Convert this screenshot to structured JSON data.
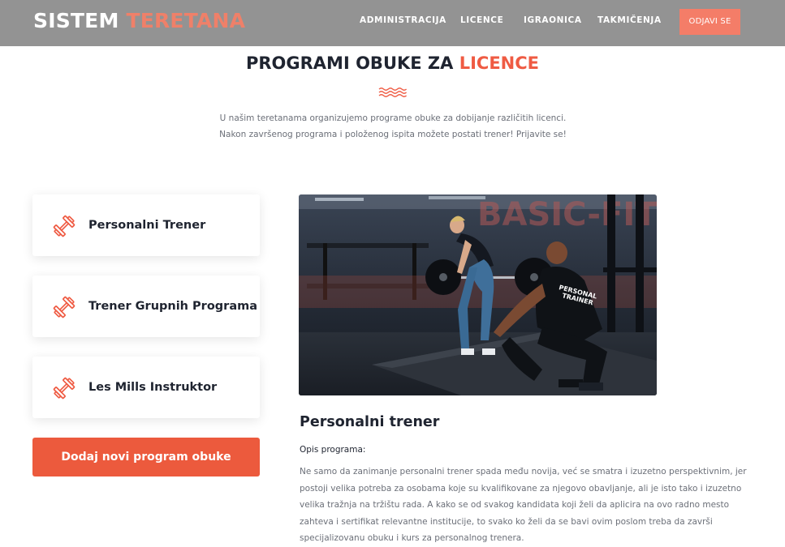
{
  "header": {
    "brand_part1": "SISTEM",
    "brand_part2": "TERETANA",
    "nav": [
      "ADMINISTRACIJA",
      "LICENCE",
      "IGRAONICA",
      "TAKMIČENJA"
    ],
    "logout_label": "ODJAVI SE"
  },
  "hero": {
    "title_main": "PROGRAMI OBUKE ZA",
    "title_accent": "LICENCE",
    "intro": "U našim teretanama organizujemo programe obuke za dobijanje različitih licenci. Nakon završenog programa i položenog ispita možete postati trener! Prijavite se!"
  },
  "programs": [
    {
      "label": "Personalni Trener",
      "icon": "dumbbell-icon"
    },
    {
      "label": "Trener Grupnih Programa",
      "icon": "dumbbell-icon"
    },
    {
      "label": "Les Mills Instruktor",
      "icon": "dumbbell-icon"
    }
  ],
  "add_button_label": "Dodaj novi program obuke",
  "detail": {
    "image_text_wall": "BASIC-FIT",
    "image_text_shirt_line1": "PERSONAL",
    "image_text_shirt_line2": "TRAINER",
    "title": "Personalni trener",
    "opis_label": "Opis programa:",
    "description": "Ne samo da zanimanje personalni trener spada među novija, već se smatra i izuzetno perspektivnim, jer postoji velika potreba za osobama koje su kvalifikovane za njegovo obavljanje, ali je isto tako i izuzetno velika tražnja na tržištu rada. A kako se od svakog kandidata koji želi da aplicira na ovo radno mesto zahteva i sertifikat relevantne institucije, to svako ko želi da se bavi ovim poslom treba da završi specijalizovanu obuku i kurs za personalnog trenera."
  },
  "colors": {
    "navbar_bg": "#939393",
    "accent": "#ef5b43",
    "logout_bg": "#f47d68"
  }
}
